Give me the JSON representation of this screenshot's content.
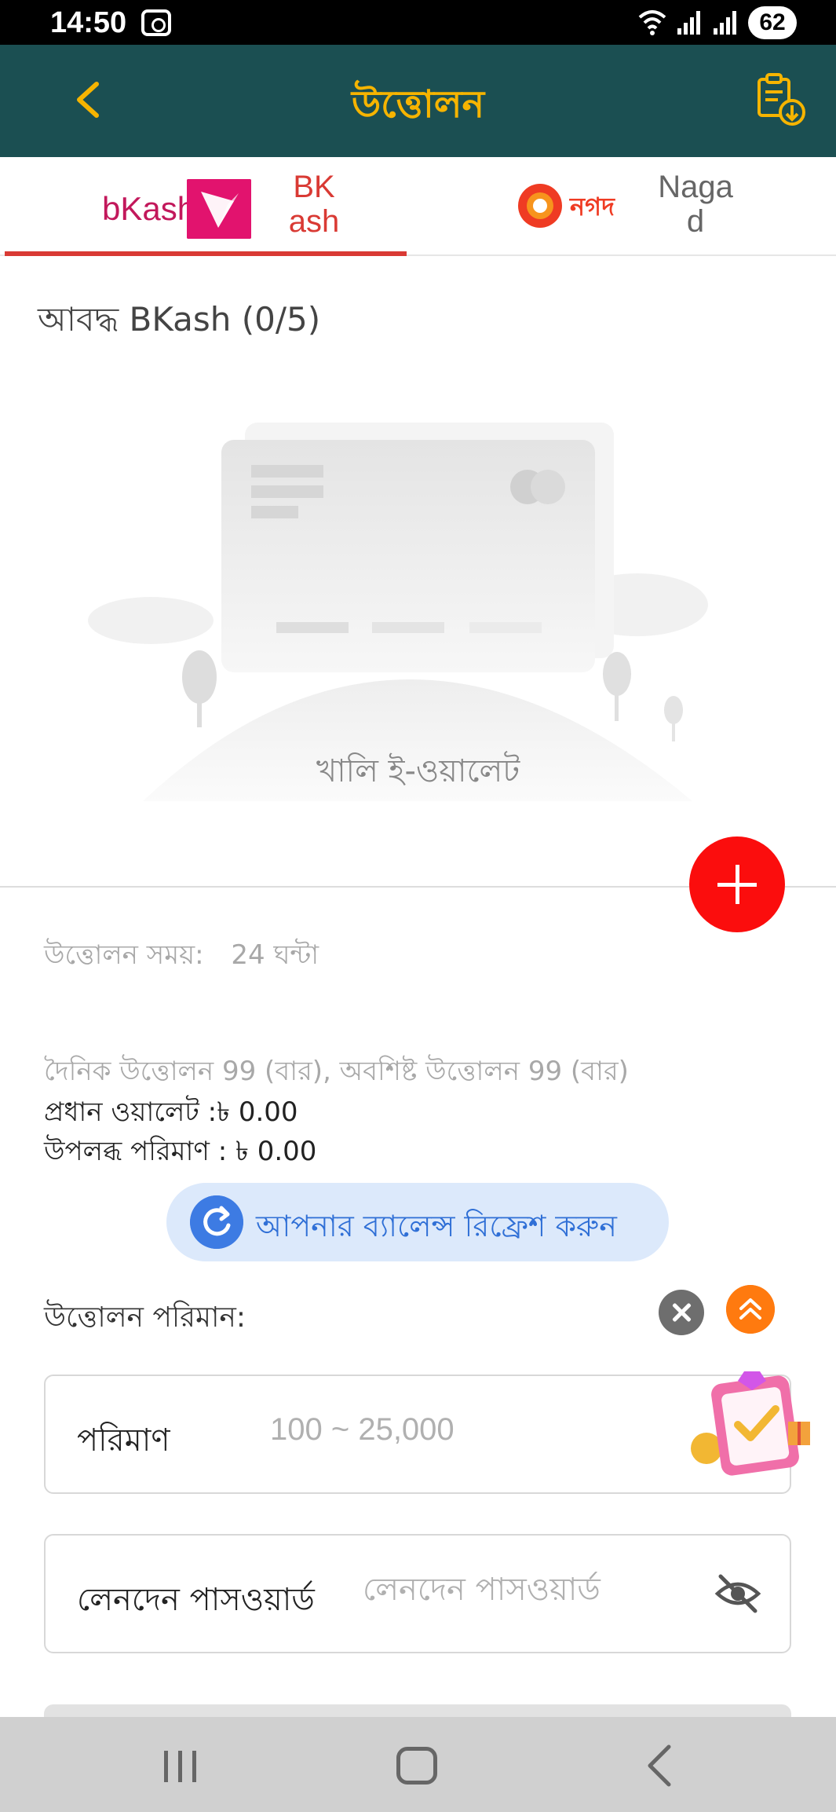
{
  "status_bar": {
    "time": "14:50",
    "battery": "62"
  },
  "header": {
    "title": "উত্তোলন",
    "back_icon": "chevron-left-icon",
    "record_icon": "clipboard-download-icon"
  },
  "tabs": [
    {
      "logo_text": "bKash",
      "label": "BK\nash",
      "active": true
    },
    {
      "logo_text": "নগদ",
      "label": "Naga\nd",
      "active": false
    }
  ],
  "bound_wallets": {
    "title": "আবদ্ধ BKash (0/5)",
    "empty_label": "খালি ই-ওয়ালেট"
  },
  "withdraw_info": {
    "time_label": "উত্তোলন সময়:",
    "time_value": "24 ঘন্টা",
    "daily_limit": "দৈনিক উত্তোলন 99 (বার), অবশিষ্ট উত্তোলন 99 (বার)",
    "main_wallet": "প্রধান ওয়ালেট :৳ 0.00",
    "available_amount": "উপলব্ধ পরিমাণ : ৳ 0.00"
  },
  "refresh": {
    "label": "আপনার ব্যালেন্স রিফ্রেশ করুন"
  },
  "amount_section": {
    "label": "উত্তোলন পরিমান:"
  },
  "amount_field": {
    "label": "পরিমাণ",
    "placeholder": "100 ~ 25,000"
  },
  "password_field": {
    "label": "লেনদেন পাসওয়ার্ড",
    "placeholder": "লেনদেন পাসওয়ার্ড"
  },
  "colors": {
    "header_bg": "#1b4f52",
    "title": "#f6b400",
    "active_tab": "#d93a34",
    "fab": "#fb0d0d",
    "refresh_text": "#2f6fd6"
  }
}
